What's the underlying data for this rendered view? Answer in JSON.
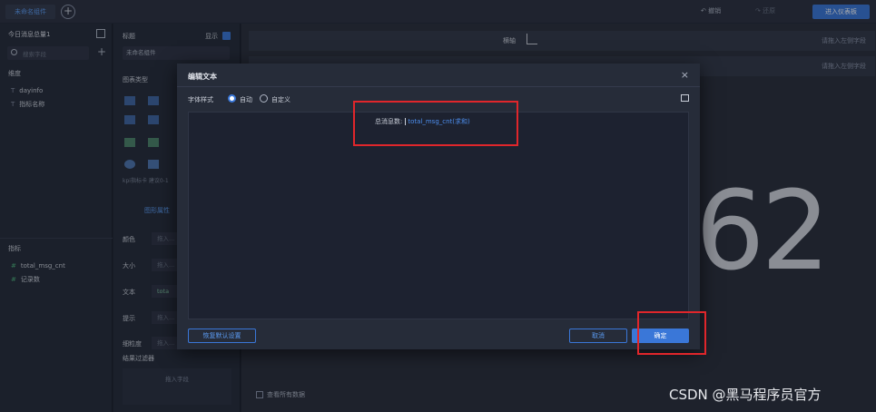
{
  "topbar": {
    "tab": "未命名组件",
    "add_tab": "+",
    "undo": "撤销",
    "redo": "还原",
    "enter_dashboard": "进入仪表板"
  },
  "left_panel": {
    "dataset_title": "今日消息总量1",
    "search_placeholder": "搜索字段",
    "add_field": "+",
    "dimension_label": "维度",
    "dimensions": [
      {
        "type": "T",
        "name": "dayinfo"
      },
      {
        "type": "T",
        "name": "指标名称"
      }
    ],
    "handle": "...",
    "metric_label": "指标",
    "metrics": [
      {
        "type": "#",
        "name": "total_msg_cnt"
      },
      {
        "type": "#",
        "name": "记录数"
      }
    ]
  },
  "config_panel": {
    "title_label": "标题",
    "show_label": "显示",
    "title_value": "未命名组件",
    "chart_type_label": "图表类型",
    "chart_hint": "kpi指标卡 建议0-1",
    "tab_label": "图形属性",
    "rows": [
      {
        "label": "颜色",
        "drop": "拖入..."
      },
      {
        "label": "大小",
        "drop": "拖入..."
      },
      {
        "label": "文本",
        "drop": "tota"
      },
      {
        "label": "提示",
        "drop": "拖入..."
      },
      {
        "label": "细粒度",
        "drop": "拖入..."
      }
    ],
    "filter_label": "结果过滤器",
    "filter_drop": "拖入字段"
  },
  "canvas": {
    "row1_label": "横轴",
    "row_hint": "请拖入左侧字段",
    "big_number": "62",
    "show_all_data": "查看所有数据"
  },
  "modal": {
    "title": "编辑文本",
    "close": "×",
    "font_style_label": "字体样式",
    "radio_auto": "自动",
    "radio_custom": "自定义",
    "editor_prefix": "总消息数:",
    "editor_tag": "total_msg_cnt(求和)",
    "reset_button": "恢复默认设置",
    "cancel_button": "取消",
    "ok_button": "确定"
  },
  "watermark": "CSDN @黑马程序员官方",
  "colors": {
    "accent": "#3a77d8",
    "highlight": "#e0262b",
    "background": "#1f2430"
  }
}
